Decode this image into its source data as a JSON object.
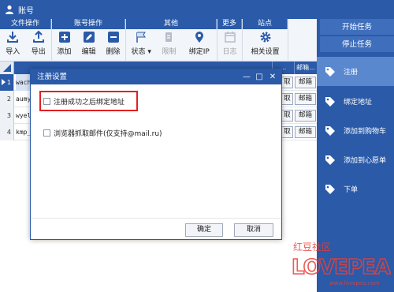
{
  "window": {
    "title": "账号"
  },
  "toolbar": {
    "groups": [
      {
        "title": "文件操作",
        "buttons": [
          {
            "label": "导入"
          },
          {
            "label": "导出"
          }
        ]
      },
      {
        "title": "账号操作",
        "buttons": [
          {
            "label": "添加"
          },
          {
            "label": "编辑"
          },
          {
            "label": "删除"
          }
        ]
      },
      {
        "title": "其他",
        "buttons": [
          {
            "label": "状态"
          },
          {
            "label": "限制"
          },
          {
            "label": "绑定IP"
          }
        ]
      },
      {
        "title": "更多",
        "buttons": [
          {
            "label": "日志"
          }
        ]
      },
      {
        "title": "站点",
        "buttons": [
          {
            "label": "相关设置"
          }
        ]
      }
    ]
  },
  "grid": {
    "columns": {
      "partial": "...",
      "mail": "邮箱..."
    },
    "rows": [
      {
        "num": "1",
        "account": "wach",
        "btn1": "取",
        "btn2": "邮箱"
      },
      {
        "num": "2",
        "account": "aumy",
        "btn1": "取",
        "btn2": "邮箱"
      },
      {
        "num": "3",
        "account": "wyel",
        "btn1": "取",
        "btn2": "邮箱"
      },
      {
        "num": "4",
        "account": "kmp_",
        "btn1": "取",
        "btn2": "邮箱"
      }
    ]
  },
  "rightpanel": {
    "start": "开始任务",
    "stop": "停止任务",
    "items": [
      {
        "label": "注册"
      },
      {
        "label": "绑定地址"
      },
      {
        "label": "添加到购物车"
      },
      {
        "label": "添加到心愿单"
      },
      {
        "label": "下单"
      }
    ]
  },
  "dialog": {
    "title": "注册设置",
    "controls": {
      "minimize": "—",
      "maximize": "□",
      "close": "✕"
    },
    "option1": "注册成功之后绑定地址",
    "option2": "浏览器抓取邮件(仅支持@mail.ru)",
    "ok": "确定",
    "cancel": "取消"
  },
  "watermark": {
    "line1": "红豆社区",
    "url": "www.lovepea.com"
  },
  "colors": {
    "primary": "#2a5aa8",
    "highlight": "#e02020",
    "watermark_red": "#e8403a"
  }
}
